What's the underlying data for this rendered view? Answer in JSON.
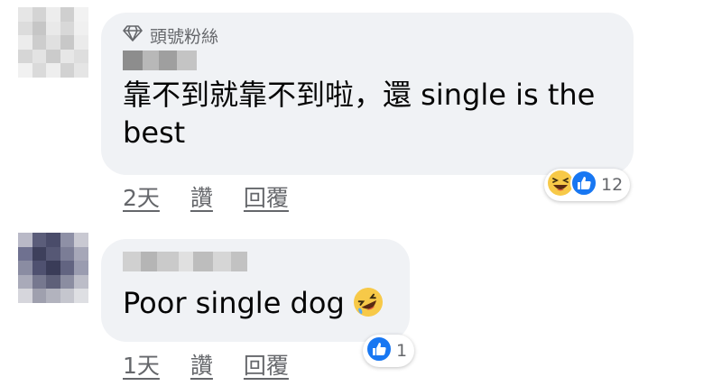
{
  "comments": [
    {
      "badge_label": "頭號粉絲",
      "badge_icon": "diamond-icon",
      "text": "靠不到就靠不到啦，還 single is the best",
      "actions": {
        "time": "2天",
        "like": "讚",
        "reply": "回覆"
      },
      "reactions": {
        "icons": [
          "haha-icon",
          "like-icon"
        ],
        "count": "12"
      }
    },
    {
      "text": "Poor single dog",
      "inline_emoji": "rofl-emoji-icon",
      "actions": {
        "time": "1天",
        "like": "讚",
        "reply": "回覆"
      },
      "reactions": {
        "icons": [
          "like-icon"
        ],
        "count": "1"
      }
    }
  ],
  "colors": {
    "bubble": "#f0f2f5",
    "meta_text": "#65676b",
    "like_blue": "#1877f2",
    "emoji_yellow": "#f7c948"
  }
}
